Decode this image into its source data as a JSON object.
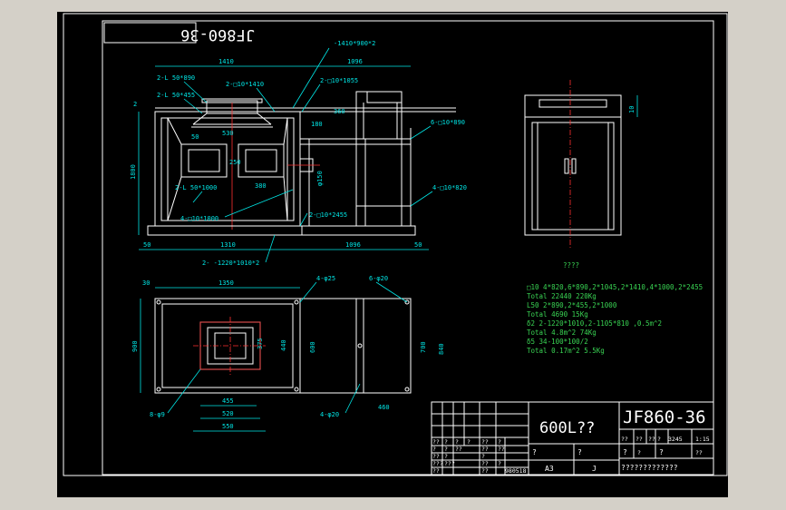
{
  "drawing_code_mirrored": "JF860-36",
  "front_view": {
    "dims": {
      "top_left_width": "1410",
      "top_right_width": "1096",
      "top_plate": "-1410*900*2",
      "angle_890": "2-L 50*890",
      "angle_455": "2-L 50*455",
      "channel_1410": "2-□10*1410",
      "channel_1055": "2-□10*1055",
      "dim_50": "50",
      "dim_530": "530",
      "dim_250": "250",
      "dim_380": "380",
      "dim_180": "180",
      "dim_360": "360",
      "channel_890": "6-□10*890",
      "angle_1000": "2-L 50*1000",
      "channel_1000": "4-□10*1000",
      "dia_150": "φ150",
      "channel_2455": "2-□10*2455",
      "channel_820": "4-□10*820",
      "height_1800": "1800",
      "dim_2": "2",
      "bottom_50_left": "50",
      "bottom_1310": "1310",
      "bottom_1096": "1096",
      "bottom_50_right": "50",
      "bottom_plate": "2- -1220*1010*2"
    }
  },
  "plan_view": {
    "dims": {
      "dim_30": "30",
      "dim_1350": "1350",
      "holes_25": "4-φ25",
      "holes_20_top": "6-φ20",
      "dim_900": "900",
      "dim_375": "375",
      "dim_440": "440",
      "dim_600": "600",
      "dim_700": "700",
      "dim_840": "840",
      "dim_455": "455",
      "dim_520": "520",
      "dim_550": "550",
      "dim_460": "460",
      "holes_9": "8-φ9",
      "holes_20_bottom": "4-φ20"
    }
  },
  "side_view": {
    "dim_10": "10"
  },
  "notes": {
    "title": "????",
    "lines": [
      "□10  4*820,6*890,2*1045,2*1410,4*1000,2*2455",
      "   Total  22440   220Kg",
      "L50  2*890,2*455,2*1000",
      "   Total  4690   15Kg",
      "δ2   2-1220*1010,2-1105*810  ,0.5m^2",
      "   Total  4.8m^2   74Kg",
      "δ5   34-100*100/2",
      "   Total  0.17m^2   5.5Kg"
    ]
  },
  "title_block": {
    "name": "600L??",
    "code": "JF860-36",
    "scale_values": [
      "3245",
      "1:15"
    ],
    "sheet": "A3",
    "sheet_mark": "J",
    "company": "?????????????",
    "q1": "?",
    "q2": "?",
    "q3": "?",
    "q4": "?",
    "date": "980518",
    "cells": [
      "??",
      "?",
      "?",
      "?",
      "??",
      "?",
      "?",
      "?",
      "??",
      "??",
      "??",
      "??",
      "?",
      "?",
      "???",
      "???",
      "??",
      "?",
      "??",
      "??",
      "??",
      "??",
      "??",
      "?",
      "?",
      "??"
    ]
  }
}
